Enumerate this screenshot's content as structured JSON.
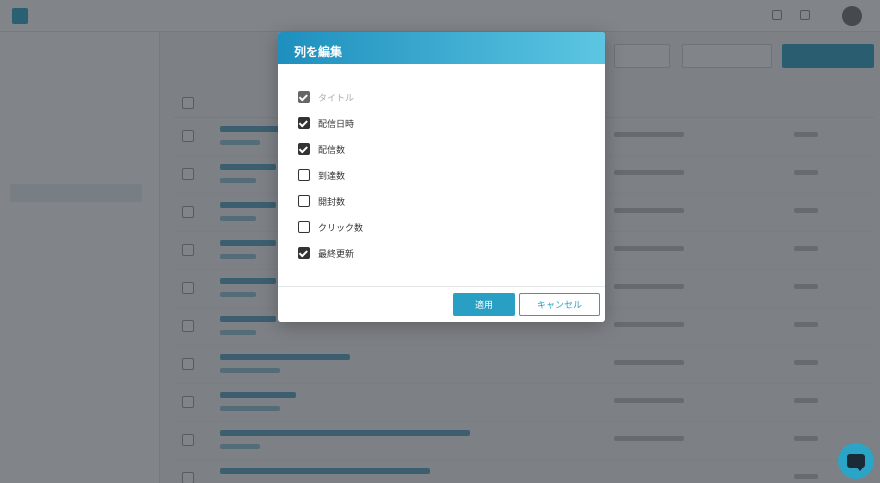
{
  "modal": {
    "title": "列を編集",
    "options": [
      {
        "label": "タイトル",
        "checked": true,
        "disabled": true
      },
      {
        "label": "配信日時",
        "checked": true,
        "disabled": false
      },
      {
        "label": "配信数",
        "checked": true,
        "disabled": false
      },
      {
        "label": "到達数",
        "checked": false,
        "disabled": false
      },
      {
        "label": "開封数",
        "checked": false,
        "disabled": false
      },
      {
        "label": "クリック数",
        "checked": false,
        "disabled": false
      },
      {
        "label": "最終更新",
        "checked": true,
        "disabled": false
      }
    ],
    "apply_label": "適用",
    "cancel_label": "キャンセル"
  },
  "colors": {
    "accent": "#2a9fc4",
    "header_start": "#1e8fbe",
    "header_end": "#5cc6e2"
  }
}
